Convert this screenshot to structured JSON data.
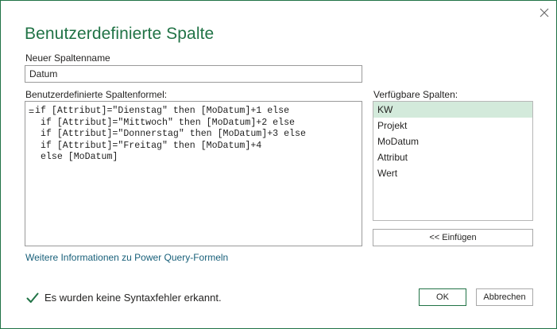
{
  "dialog": {
    "title": "Benutzerdefinierte Spalte",
    "close_icon": "close-icon"
  },
  "name_field": {
    "label": "Neuer Spaltenname",
    "value": "Datum"
  },
  "formula": {
    "label": "Benutzerdefinierte Spaltenformel:",
    "equals": "=",
    "text": "if [Attribut]=\"Dienstag\" then [MoDatum]+1 else\n if [Attribut]=\"Mittwoch\" then [MoDatum]+2 else\n if [Attribut]=\"Donnerstag\" then [MoDatum]+3 else\n if [Attribut]=\"Freitag\" then [MoDatum]+4\n else [MoDatum]"
  },
  "available_columns": {
    "label": "Verfügbare Spalten:",
    "items": [
      "KW",
      "Projekt",
      "MoDatum",
      "Attribut",
      "Wert"
    ],
    "selected": "KW",
    "insert_label": "<< Einfügen"
  },
  "more_info_link": "Weitere Informationen zu Power Query-Formeln",
  "status": {
    "icon": "check-icon",
    "text": "Es wurden keine Syntaxfehler erkannt.",
    "color": "#217346"
  },
  "buttons": {
    "ok": "OK",
    "cancel": "Abbrechen"
  },
  "colors": {
    "accent": "#217346",
    "selection": "#d3eadb",
    "link": "#19607a"
  }
}
